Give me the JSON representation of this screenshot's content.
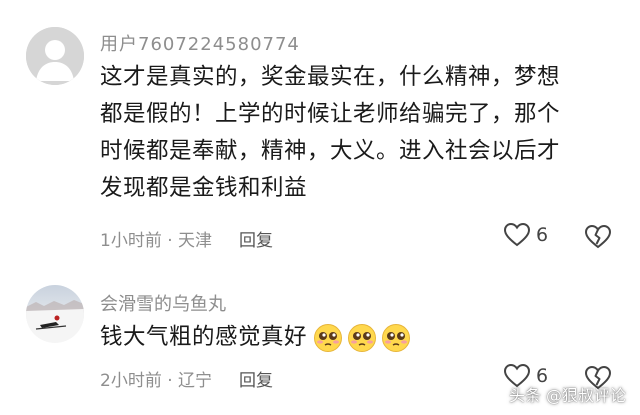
{
  "comments": [
    {
      "username": "用户7607224580774",
      "lines": [
        "这才是真实的，奖金最实在，什么精神，梦想",
        "都是假的！上学的时候让老师给骗完了，那个",
        "时候都是奉献，精神，大义。进入社会以后才",
        "发现都是金钱和利益"
      ],
      "meta": "1小时前 · 天津",
      "reply_label": "回复",
      "likes": "6",
      "avatar_icon": "default-user-avatar"
    },
    {
      "username": "会滑雪的乌鱼丸",
      "text": "钱大气粗的感觉真好",
      "emojis": [
        "pleading-face-emoji",
        "pleading-face-emoji",
        "pleading-face-emoji"
      ],
      "meta": "2小时前 · 辽宁",
      "reply_label": "回复",
      "likes": "6",
      "avatar_icon": "skiing-photo-avatar"
    }
  ],
  "watermark": "头条 @狠叔评论",
  "colors": {
    "secondary_text": "#8e8e8e",
    "primary_text": "#1a1a1a",
    "emoji_yellow": "#ffd84d"
  }
}
